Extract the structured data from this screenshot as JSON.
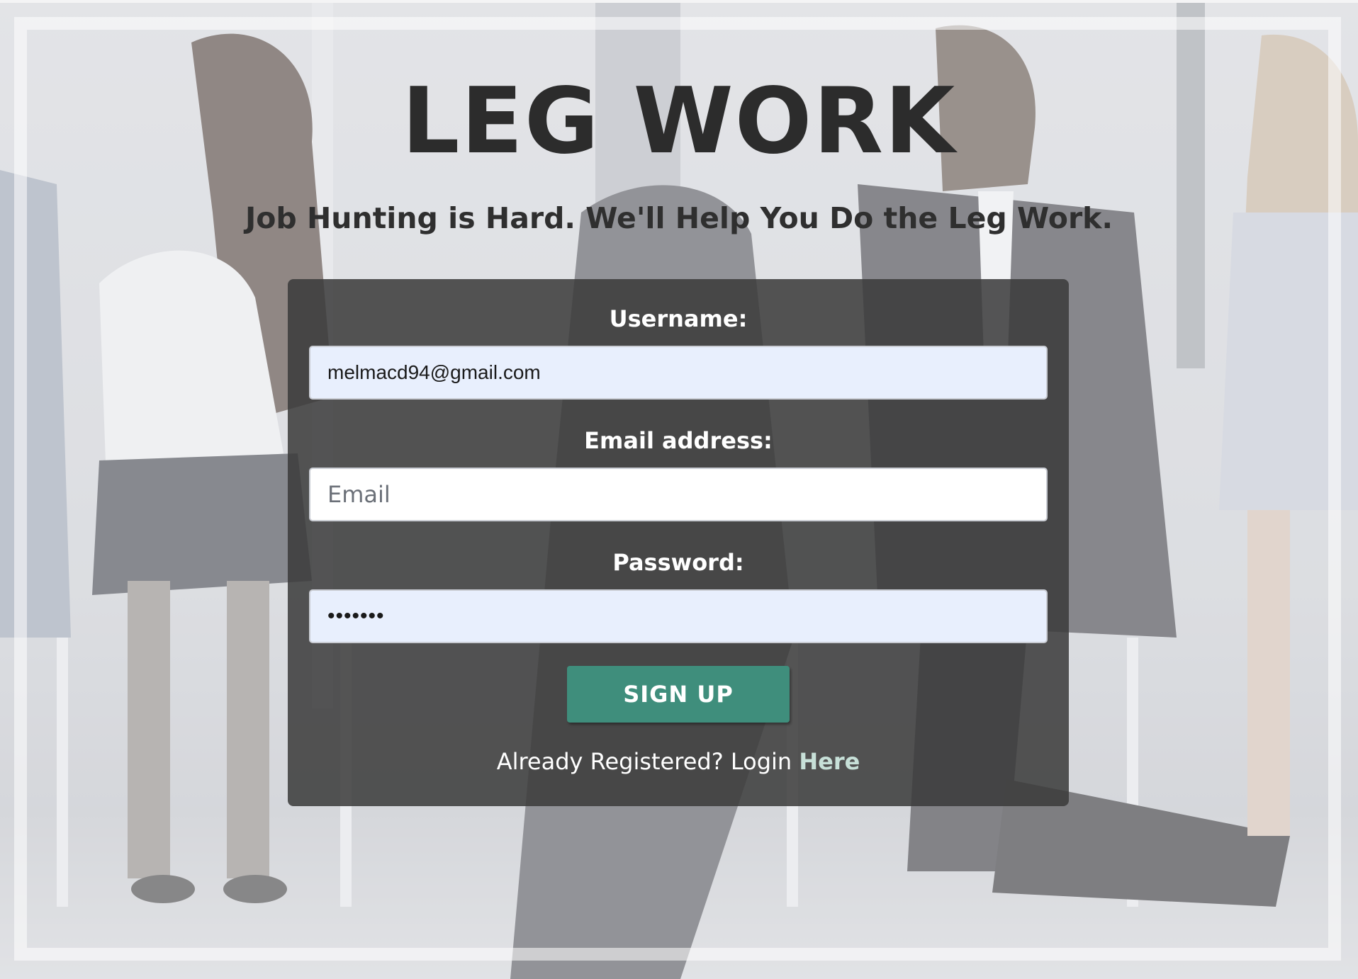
{
  "header": {
    "title": "LEG WORK",
    "tagline": "Job Hunting is Hard. We'll Help You Do the Leg Work."
  },
  "form": {
    "username": {
      "label": "Username:",
      "value": "melmacd94@gmail.com"
    },
    "email": {
      "label": "Email address:",
      "value": "",
      "placeholder": "Email"
    },
    "password": {
      "label": "Password:",
      "value": "•••••••"
    },
    "submit_label": "SIGN UP",
    "login_prompt": "Already Registered? Login",
    "login_link": "Here"
  },
  "colors": {
    "card_background": "#3a3a3a",
    "button_accent": "#3f8e7c",
    "autofill_background": "#e8effd",
    "link": "#c7e0d8"
  }
}
